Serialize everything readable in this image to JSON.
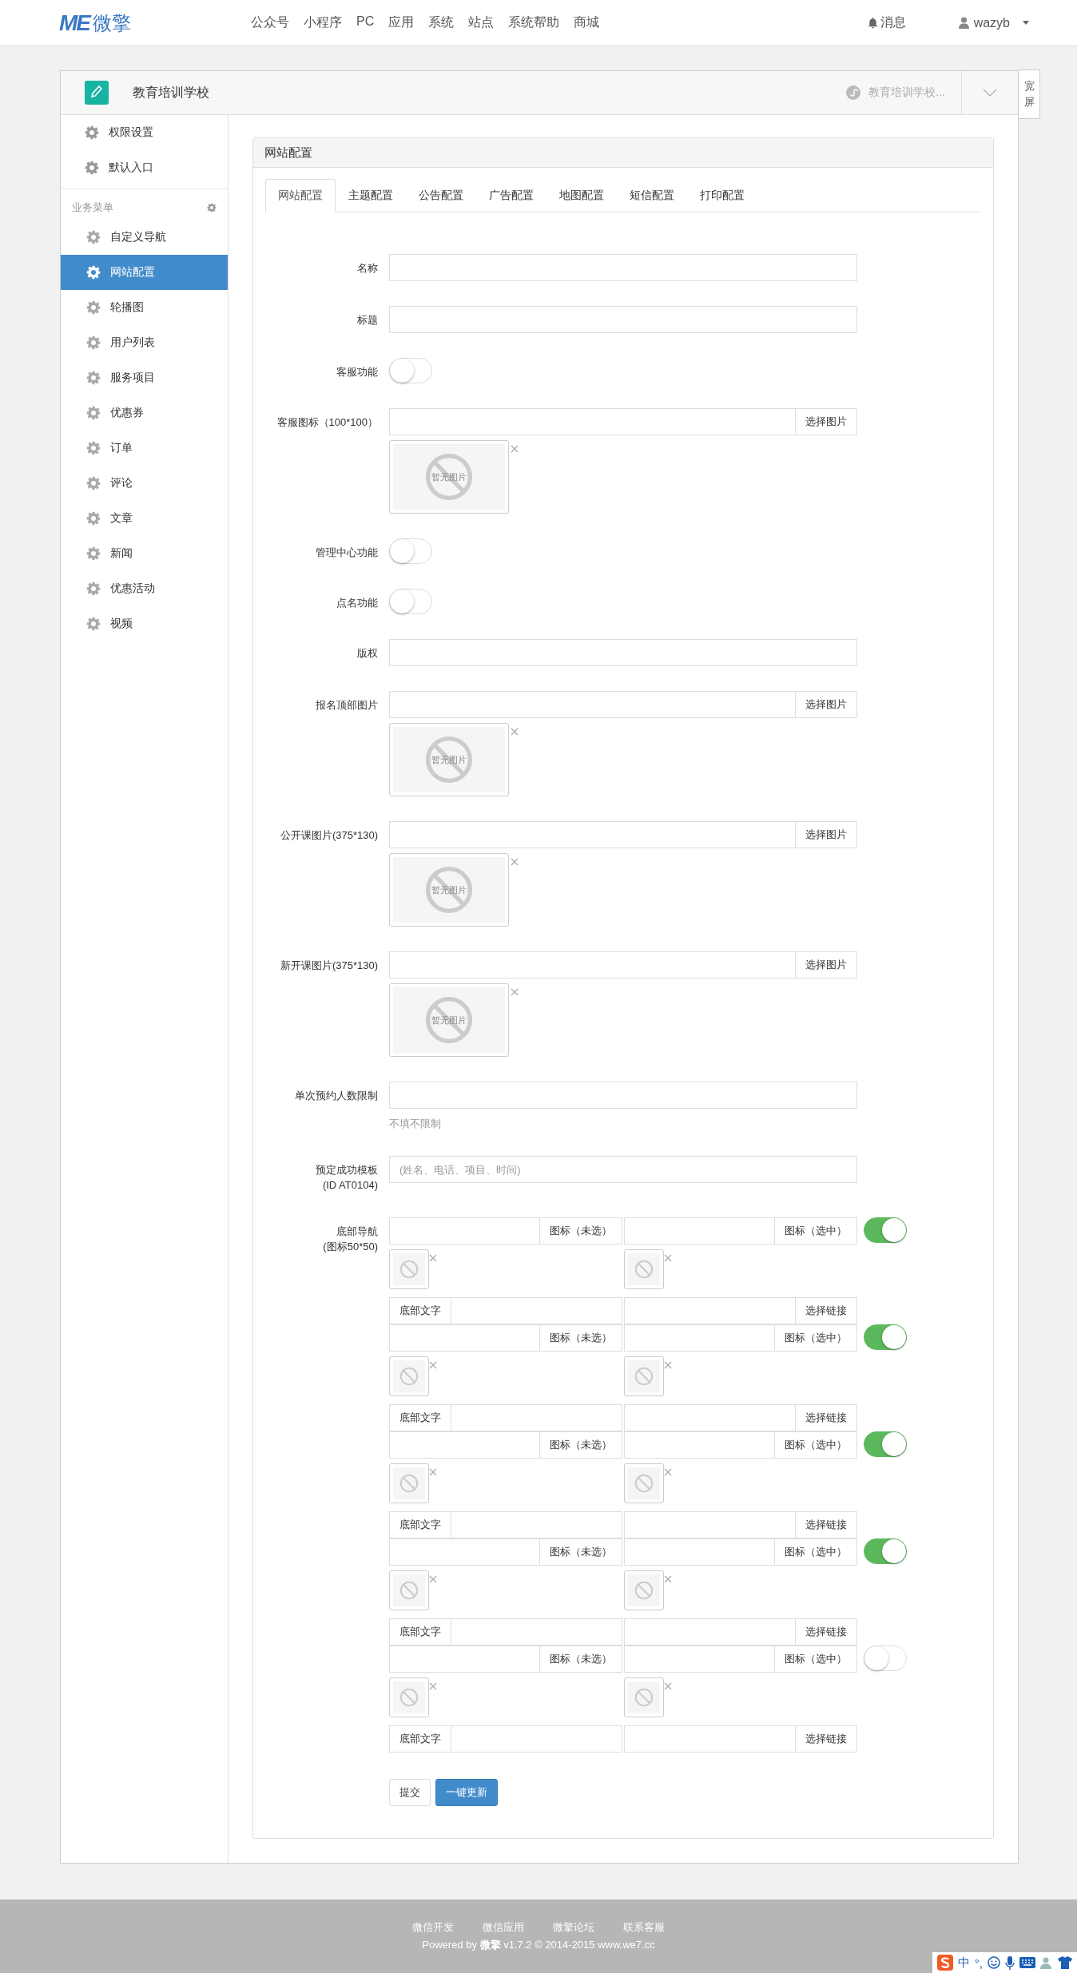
{
  "header": {
    "logo_mark": "ME",
    "logo_name": "微擎",
    "nav": [
      "公众号",
      "小程序",
      "PC",
      "应用",
      "系统",
      "站点",
      "系统帮助",
      "商城"
    ],
    "messages": "消息",
    "user": "wazyb"
  },
  "account": {
    "name": "教育培训学校",
    "switch_label": "教育培训学校...",
    "wide_button": "宽屏"
  },
  "sidebar": {
    "top_items": [
      {
        "label": "权限设置",
        "selected": false
      },
      {
        "label": "默认入口",
        "selected": false
      }
    ],
    "group": "业务菜单",
    "items": [
      {
        "label": "自定义导航",
        "selected": false
      },
      {
        "label": "网站配置",
        "selected": true
      },
      {
        "label": "轮播图",
        "selected": false
      },
      {
        "label": "用户列表",
        "selected": false
      },
      {
        "label": "服务项目",
        "selected": false
      },
      {
        "label": "优惠券",
        "selected": false
      },
      {
        "label": "订单",
        "selected": false
      },
      {
        "label": "评论",
        "selected": false
      },
      {
        "label": "文章",
        "selected": false
      },
      {
        "label": "新闻",
        "selected": false
      },
      {
        "label": "优惠活动",
        "selected": false
      },
      {
        "label": "视频",
        "selected": false
      }
    ]
  },
  "panel": {
    "title": "网站配置",
    "tabs": [
      {
        "label": "网站配置",
        "selected": true
      },
      {
        "label": "主题配置",
        "selected": false
      },
      {
        "label": "公告配置",
        "selected": false
      },
      {
        "label": "广告配置",
        "selected": false
      },
      {
        "label": "地图配置",
        "selected": false
      },
      {
        "label": "短信配置",
        "selected": false
      },
      {
        "label": "打印配置",
        "selected": false
      }
    ],
    "fields": [
      {
        "kind": "text",
        "label": "名称"
      },
      {
        "kind": "text",
        "label": "标题"
      },
      {
        "kind": "switch",
        "label": "客服功能",
        "on": false
      },
      {
        "kind": "image",
        "label": "客服图标（100*100）",
        "button": "选择图片",
        "preview_text": "暂无图片"
      },
      {
        "kind": "switch",
        "label": "管理中心功能",
        "on": false
      },
      {
        "kind": "switch",
        "label": "点名功能",
        "on": false
      },
      {
        "kind": "text",
        "label": "版权"
      },
      {
        "kind": "image",
        "label": "报名顶部图片",
        "button": "选择图片",
        "preview_text": "暂无图片"
      },
      {
        "kind": "image",
        "label": "公开课图片(375*130)",
        "button": "选择图片",
        "preview_text": "暂无图片"
      },
      {
        "kind": "image",
        "label": "新开课图片(375*130)",
        "button": "选择图片",
        "preview_text": "暂无图片"
      },
      {
        "kind": "hint",
        "label": "单次预约人数限制",
        "hint": "不填不限制"
      },
      {
        "kind": "placeholder",
        "label": "预定成功模板",
        "sublabel": "(ID AT0104)",
        "placeholder": "(姓名、电话、项目、时间)"
      }
    ],
    "bottom_nav": {
      "label": "底部导航",
      "sublabel": "(图标50*50)",
      "items": [
        {
          "icon_normal": "图标（未选）",
          "icon_active": "图标（选中）",
          "text_addon": "底部文字",
          "link_button": "选择链接",
          "on": true
        },
        {
          "icon_normal": "图标（未选）",
          "icon_active": "图标（选中）",
          "text_addon": "底部文字",
          "link_button": "选择链接",
          "on": true
        },
        {
          "icon_normal": "图标（未选）",
          "icon_active": "图标（选中）",
          "text_addon": "底部文字",
          "link_button": "选择链接",
          "on": true
        },
        {
          "icon_normal": "图标（未选）",
          "icon_active": "图标（选中）",
          "text_addon": "底部文字",
          "link_button": "选择链接",
          "on": true
        },
        {
          "icon_normal": "图标（未选）",
          "icon_active": "图标（选中）",
          "text_addon": "底部文字",
          "link_button": "选择链接",
          "on": false
        }
      ]
    },
    "buttons": [
      {
        "label": "提交",
        "kind": "default"
      },
      {
        "label": "一键更新",
        "kind": "primary"
      }
    ]
  },
  "footer": {
    "links": [
      "微信开发",
      "微信应用",
      "微擎论坛",
      "联系客服"
    ],
    "powered": "Powered by **微擎** v1.7.2 © 2014-2015 www.we7.cc"
  },
  "ime": {
    "lang": "中",
    "punct": "°,"
  }
}
